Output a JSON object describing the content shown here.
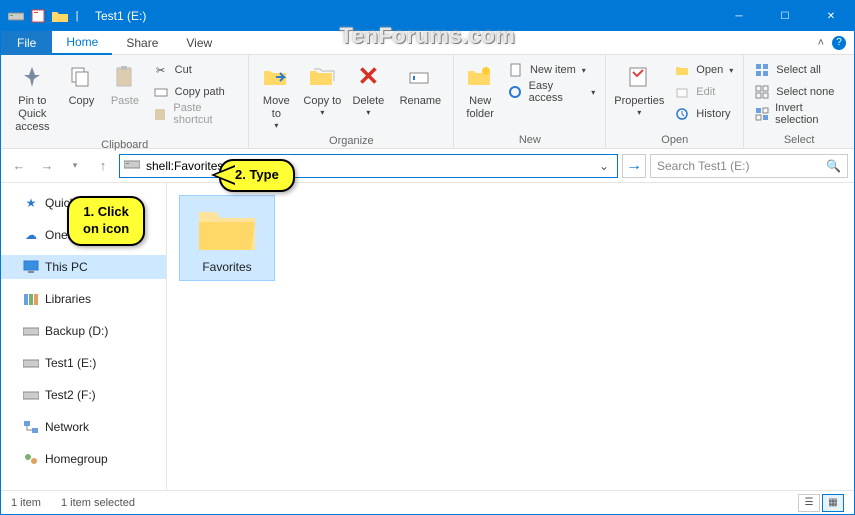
{
  "window": {
    "title": "Test1 (E:)"
  },
  "tabs": {
    "file": "File",
    "home": "Home",
    "share": "Share",
    "view": "View"
  },
  "ribbon": {
    "clipboard": {
      "label": "Clipboard",
      "pin": "Pin to Quick access",
      "copy": "Copy",
      "paste": "Paste",
      "cut": "Cut",
      "copypath": "Copy path",
      "pasteshortcut": "Paste shortcut"
    },
    "organize": {
      "label": "Organize",
      "moveto": "Move to",
      "copyto": "Copy to",
      "delete": "Delete",
      "rename": "Rename"
    },
    "new": {
      "label": "New",
      "newfolder": "New folder",
      "newitem": "New item",
      "easyaccess": "Easy access"
    },
    "open": {
      "label": "Open",
      "properties": "Properties",
      "open": "Open",
      "edit": "Edit",
      "history": "History"
    },
    "select": {
      "label": "Select",
      "selectall": "Select all",
      "selectnone": "Select none",
      "invert": "Invert selection"
    }
  },
  "addressbar": {
    "value": "shell:Favorites"
  },
  "search": {
    "placeholder": "Search Test1 (E:)"
  },
  "nav": {
    "quick": "Quick access",
    "onedrive": "OneDrive",
    "thispc": "This PC",
    "libraries": "Libraries",
    "backup": "Backup (D:)",
    "test1": "Test1 (E:)",
    "test2": "Test2 (F:)",
    "network": "Network",
    "homegroup": "Homegroup"
  },
  "items": {
    "favorites": "Favorites"
  },
  "status": {
    "count": "1 item",
    "selected": "1 item selected"
  },
  "callouts": {
    "c1a": "1. Click",
    "c1b": "on icon",
    "c2": "2. Type"
  },
  "watermark": "TenForums.com"
}
